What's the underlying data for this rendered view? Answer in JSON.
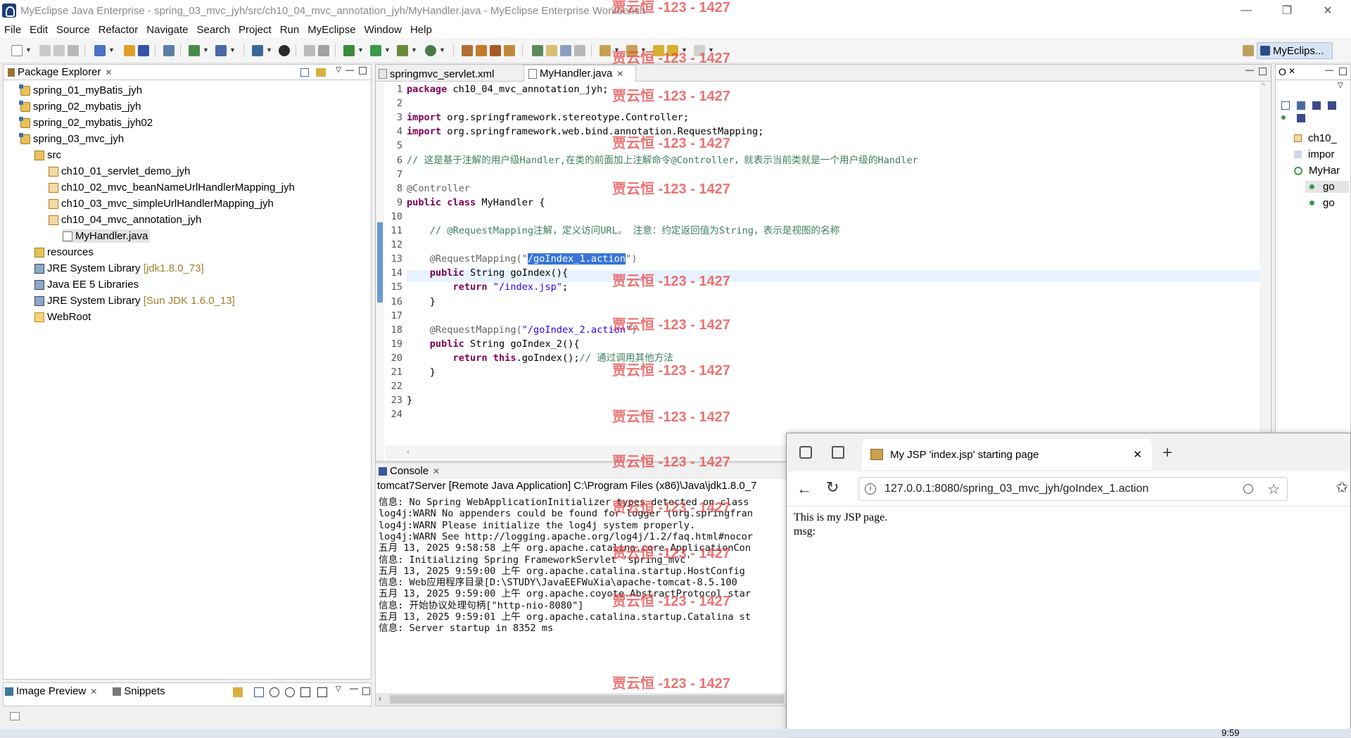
{
  "window": {
    "title": "MyEclipse Java Enterprise - spring_03_mvc_jyh/src/ch10_04_mvc_annotation_jyh/MyHandler.java - MyEclipse Enterprise Workbench",
    "minimize": "—",
    "maximize": "❐",
    "close": "✕"
  },
  "menu": [
    "File",
    "Edit",
    "Source",
    "Refactor",
    "Navigate",
    "Search",
    "Project",
    "Run",
    "MyEclipse",
    "Window",
    "Help"
  ],
  "perspective": {
    "label": "MyEclips..."
  },
  "package_explorer": {
    "title": "Package Explorer",
    "close": "✕",
    "items": [
      {
        "label": "spring_01_myBatis_jyh",
        "deco": ""
      },
      {
        "label": "spring_02_mybatis_jyh",
        "deco": ""
      },
      {
        "label": "spring_02_mybatis_jyh02",
        "deco": ""
      },
      {
        "label": "spring_03_mvc_jyh",
        "deco": ""
      },
      {
        "label": "src",
        "deco": ""
      },
      {
        "label": "ch10_01_servlet_demo_jyh",
        "deco": ""
      },
      {
        "label": "ch10_02_mvc_beanNameUrlHandlerMapping_jyh",
        "deco": ""
      },
      {
        "label": "ch10_03_mvc_simpleUrlHandlerMapping_jyh",
        "deco": ""
      },
      {
        "label": "ch10_04_mvc_annotation_jyh",
        "deco": ""
      },
      {
        "label": "MyHandler.java",
        "deco": ""
      },
      {
        "label": "resources",
        "deco": ""
      },
      {
        "label": "JRE System Library",
        "deco": "[jdk1.8.0_73]"
      },
      {
        "label": "Java EE 5 Libraries",
        "deco": ""
      },
      {
        "label": "JRE System Library",
        "deco": "[Sun JDK 1.6.0_13]"
      },
      {
        "label": "WebRoot",
        "deco": ""
      }
    ]
  },
  "bottom_left": {
    "tab1": "Image Preview",
    "tab2": "Snippets"
  },
  "editor": {
    "tabs": [
      {
        "label": "springmvc_servlet.xml"
      },
      {
        "label": "MyHandler.java"
      }
    ],
    "line_numbers": [
      "1",
      "2",
      "3",
      "4",
      "5",
      "6",
      "7",
      "8",
      "9",
      "10",
      "11",
      "12",
      "13",
      "14",
      "15",
      "16",
      "17",
      "18",
      "19",
      "20",
      "21",
      "22",
      "23",
      "24"
    ],
    "lines": [
      {
        "p1": "package",
        "p2": " ch10_04_mvc_annotation_jyh;"
      },
      {
        "p1": "",
        "p2": ""
      },
      {
        "p1": "import",
        "p2": " org.springframework.stereotype.Controller;"
      },
      {
        "p1": "import",
        "p2": " org.springframework.web.bind.annotation.RequestMapping;"
      },
      {
        "p1": "",
        "p2": ""
      },
      {
        "c": "// 这是基于注解的用户级Handler,在类的前面加上注解命令@Controller，就表示当前类就是一个用户级的Handler"
      },
      {
        "p1": "",
        "p2": ""
      },
      {
        "a": "@Controller"
      },
      {
        "p1": "public class",
        "p2": " MyHandler {"
      },
      {
        "p1": "",
        "p2": ""
      },
      {
        "c": "    // @RequestMapping注解，定义访问URL。 注意：约定返回值为String，表示是视图的名称"
      },
      {
        "p1": "",
        "p2": ""
      },
      {
        "a": "    @RequestMapping(\"",
        "s": "/goIndex_1.action",
        "a2": "\")"
      },
      {
        "p0": "    ",
        "p1": "public",
        "p2": " String goIndex(){"
      },
      {
        "p0": "        ",
        "p1": "return",
        "s": " \"/index.jsp\"",
        "p2": ";"
      },
      {
        "p2": "    }"
      },
      {
        "p1": "",
        "p2": ""
      },
      {
        "a": "    @RequestMapping(",
        "s": "\"/goIndex_2.action\"",
        "a2": ")"
      },
      {
        "p0": "    ",
        "p1": "public",
        "p2": " String goIndex_2(){"
      },
      {
        "p0": "        ",
        "p1": "return this",
        "p2": ".goIndex();",
        "c": "// 通过调用其他方法"
      },
      {
        "p2": "    }"
      },
      {
        "p1": "",
        "p2": ""
      },
      {
        "p2": "}"
      },
      {
        "p1": "",
        "p2": ""
      }
    ]
  },
  "outline": {
    "items": [
      "ch10_",
      "impor",
      "MyHar",
      "go",
      "go"
    ]
  },
  "console": {
    "title": "Console",
    "header": "tomcat7Server [Remote Java Application] C:\\Program Files (x86)\\Java\\jdk1.8.0_7",
    "lines": [
      "信息: No Spring WebApplicationInitializer types detected on class",
      "log4j:WARN No appenders could be found for logger (org.springfran",
      "log4j:WARN Please initialize the log4j system properly.",
      "log4j:WARN See http://logging.apache.org/log4j/1.2/faq.html#nocor",
      "五月 13, 2025 9:58:58 上午 org.apache.catalina.core.ApplicationCon",
      "信息: Initializing Spring FrameworkServlet 'spring_mvc'",
      "五月 13, 2025 9:59:00 上午 org.apache.catalina.startup.HostConfig",
      "信息: Web应用程序目录[D:\\STUDY\\JavaEEFWuXia\\apache-tomcat-8.5.100",
      "五月 13, 2025 9:59:00 上午 org.apache.coyote.AbstractProtocol star",
      "信息: 开始协议处理句柄[\"http-nio-8080\"]",
      "五月 13, 2025 9:59:01 上午 org.apache.catalina.startup.Catalina st",
      "信息: Server startup in 8352 ms"
    ]
  },
  "browser": {
    "tab_title": "My JSP 'index.jsp' starting page",
    "tab_close": "✕",
    "new_tab": "+",
    "url": "127.0.0.1:8080/spring_03_mvc_jyh/goIndex_1.action",
    "body_line1": "This is my JSP page.",
    "body_line2": "msg:"
  },
  "watermark": "贾云恒 -123 - 1427",
  "clock": "9:59"
}
